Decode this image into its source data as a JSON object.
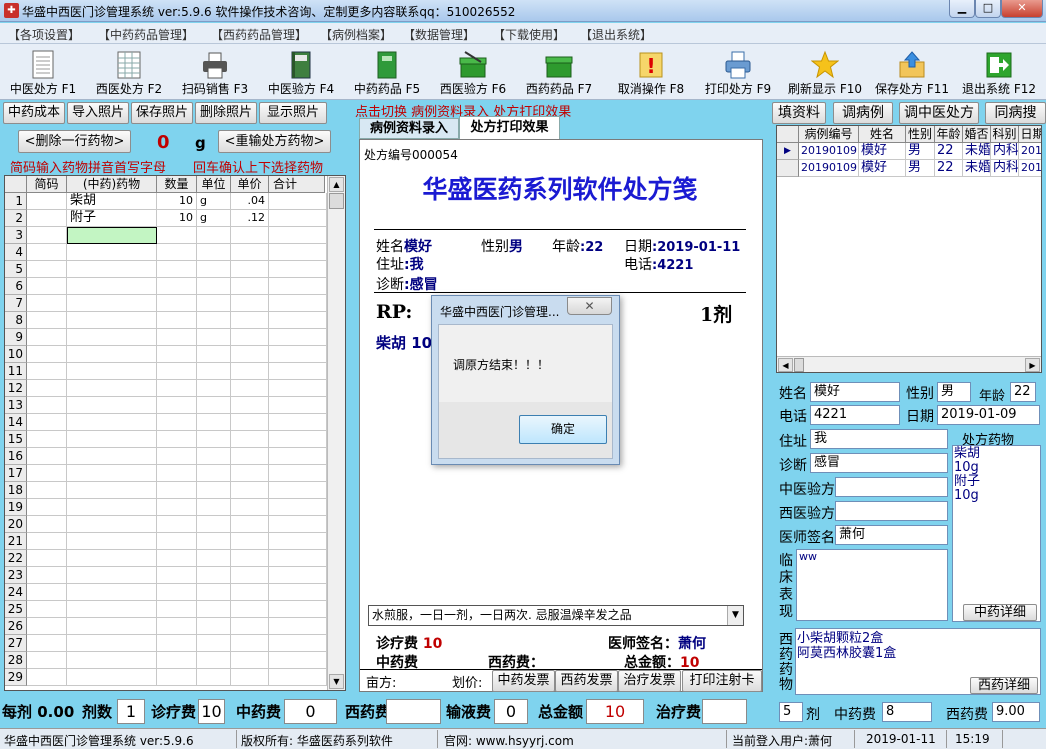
{
  "window": {
    "title": "华盛中西医门诊管理系统 ver:5.9.6    软件操作技术咨询、定制更多内容联系qq：510026552"
  },
  "menu": [
    "【各项设置】",
    "【中药药品管理】",
    "【西药药品管理】",
    "【病例档案】",
    "【数据管理】",
    "【下载使用】",
    "【退出系统】"
  ],
  "toolbar": [
    {
      "label": "中医处方 F1",
      "icon": "document-icon"
    },
    {
      "label": "西医处方 F2",
      "icon": "spreadsheet-icon"
    },
    {
      "label": "扫码销售 F3",
      "icon": "printer-icon"
    },
    {
      "label": "中医验方 F4",
      "icon": "book-icon"
    },
    {
      "label": "中药药品 F5",
      "icon": "green-book-icon"
    },
    {
      "label": "西医验方 F6",
      "icon": "green-box-icon"
    },
    {
      "label": "西药药品 F7",
      "icon": "green-box-icon"
    },
    {
      "label": "取消操作 F8",
      "icon": "warning-icon"
    },
    {
      "label": "打印处方 F9",
      "icon": "printer-icon"
    },
    {
      "label": "刷新显示 F10",
      "icon": "star-icon"
    },
    {
      "label": "保存处方 F11",
      "icon": "upload-folder-icon"
    },
    {
      "label": "退出系统 F12",
      "icon": "exit-icon"
    }
  ],
  "left": {
    "tabs": [
      "中药成本",
      "导入照片",
      "保存照片",
      "删除照片",
      "显示照片"
    ],
    "delete_row": "<删除一行药物>",
    "count": "0",
    "unit": "g",
    "reinput": "<重输处方药物>",
    "hint1": "简码输入药物拼音首写字母",
    "hint2": "回车确认上下选择药物",
    "columns": [
      "简码",
      "(中药)药物",
      "数量",
      "单位",
      "单价",
      "合计"
    ],
    "rows": [
      {
        "no": "1",
        "code": "",
        "name": "柴胡",
        "qty": "10",
        "unit": "g",
        "price": ".04",
        "total": ""
      },
      {
        "no": "2",
        "code": "",
        "name": "附子",
        "qty": "10",
        "unit": "g",
        "price": ".12",
        "total": ""
      }
    ],
    "row_numbers": [
      "1",
      "2",
      "3",
      "4",
      "5",
      "6",
      "7",
      "8",
      "9",
      "10",
      "11",
      "12",
      "13",
      "14",
      "15",
      "16",
      "17",
      "18",
      "19",
      "20",
      "21",
      "22",
      "23",
      "24",
      "25",
      "26",
      "27",
      "28",
      "29"
    ]
  },
  "middle": {
    "hint": "点击切换  病例资料录入  处方打印效果",
    "tabs": [
      "病例资料录入",
      "处方打印效果"
    ],
    "rx_no_label": "处方编号",
    "rx_no": "000054",
    "heading": "华盛医药系列软件处方笺",
    "name_label": "姓名",
    "name": "模好",
    "sex_label": "性别",
    "sex": "男",
    "age_label": "年龄",
    "age": ":22",
    "date_label": "日期",
    "date": ":2019-01-11",
    "addr_label": "住址",
    "addr": ":我",
    "tel_label": "电话",
    "tel": ":4221",
    "diag_label": "诊断",
    "diag": ":感冒",
    "rp": "RP:",
    "doses": "1剂",
    "herb": "柴胡  10",
    "usage": "水煎服，一日一剂，一日两次. 忌服温燥辛发之品",
    "fee_label": "诊疗费",
    "fee": "10",
    "doctor_label": "医师签名：",
    "doctor": "萧何",
    "zy_fee_label": "中药费",
    "xy_fee_label": "西药费：",
    "total_label": "总金额：",
    "total": "10",
    "bottom": [
      "亩方:",
      "划价:"
    ],
    "buttons": [
      "中药发票",
      "西药发票",
      "治疗发票",
      "打印注射卡"
    ]
  },
  "dialog": {
    "title": "华盛中西医门诊管理...",
    "message": "调原方结束！！！",
    "ok": "确定"
  },
  "right": {
    "tabs": [
      "填资料",
      "调病例",
      "调中医处方",
      "同病搜"
    ],
    "columns": [
      "病例编号",
      "姓名",
      "性别",
      "年龄",
      "婚否",
      "科别",
      "日期"
    ],
    "rows": [
      [
        "20190109",
        "模好",
        "男",
        "22",
        "未婚",
        "内科",
        "201"
      ],
      [
        "20190109",
        "模好",
        "男",
        "22",
        "未婚",
        "内科",
        "201"
      ]
    ],
    "name_label": "姓名",
    "name": "模好",
    "sex_label": "性别",
    "sex": "男",
    "age_label": "年龄",
    "age": "22",
    "tel_label": "电话",
    "tel": "4221",
    "date_label": "日期",
    "date": "2019-01-09",
    "addr_label": "住址",
    "addr": "我",
    "rx_drugs_label": "处方药物",
    "diag_label": "诊断",
    "diag": "感冒",
    "zy_label": "中医验方",
    "xy_label": "西医验方",
    "doctor_label": "医师签名",
    "doctor": "萧何",
    "clinical_label": "临床表现",
    "clinical": "ww",
    "drugs": [
      "柴胡",
      "10g",
      "附子",
      "10g"
    ],
    "zy_detail": "中药详细",
    "xy_drug_label": "西药药物",
    "xy_drugs": [
      "小柴胡颗粒2盒",
      "阿莫西林胶囊1盒"
    ],
    "xy_detail": "西药详细"
  },
  "bottom": {
    "per_dose_label": "每剂",
    "per_dose": "0.00",
    "doses_label": "剂数",
    "doses": "1",
    "fee_label": "诊疗费",
    "fee": "10",
    "zy_fee_label": "中药费",
    "zy_fee": "0",
    "xy_fee_label": "西药费",
    "xy_fee": "",
    "iv_fee_label": "输液费",
    "iv_fee": "0",
    "total_label": "总金额",
    "total": "10",
    "treat_label": "治疗费",
    "treat": "",
    "r_doses": "5",
    "r_doses_label": "剂",
    "r_zy_label": "中药费",
    "r_zy": "8",
    "r_xy_label": "西药费",
    "r_xy": "9.00"
  },
  "status": {
    "app": "华盛中西医门诊管理系统 ver:5.9.6",
    "copyright": "版权所有:   华盛医药系列软件",
    "site": "官网: www.hsyyrj.com",
    "user": "当前登入用户:萧何",
    "date": "2019-01-11",
    "time": "15:19"
  }
}
